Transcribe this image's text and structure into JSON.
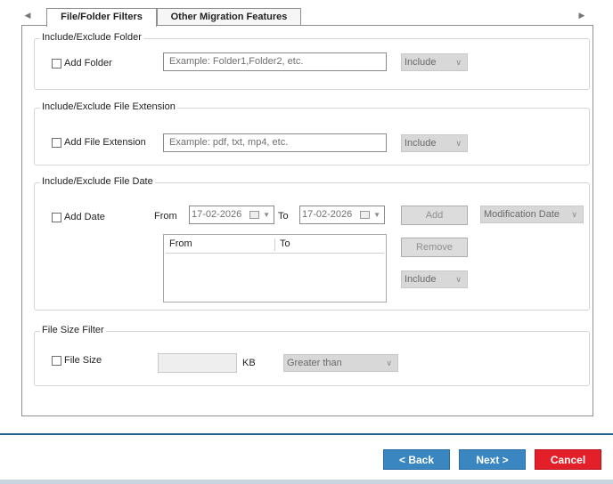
{
  "tabs": [
    {
      "label": "File/Folder Filters",
      "active": true
    },
    {
      "label": "Other Migration Features",
      "active": false
    }
  ],
  "folder_group": {
    "title": "Include/Exclude Folder",
    "checkbox_label": "Add Folder",
    "input_placeholder": "Example: Folder1,Folder2, etc.",
    "select_value": "Include"
  },
  "extension_group": {
    "title": "Include/Exclude File Extension",
    "checkbox_label": "Add File Extension",
    "input_placeholder": "Example: pdf, txt, mp4, etc.",
    "select_value": "Include"
  },
  "date_group": {
    "title": "Include/Exclude File Date",
    "checkbox_label": "Add Date",
    "from_label": "From",
    "from_value": "17-02-2026",
    "to_label": "To",
    "to_value": "17-02-2026",
    "add_label": "Add",
    "date_type_value": "Modification Date",
    "list_columns": [
      "From",
      "To"
    ],
    "remove_label": "Remove",
    "select_value": "Include"
  },
  "size_group": {
    "title": "File Size Filter",
    "checkbox_label": "File Size",
    "unit_label": "KB",
    "comparison_value": "Greater than"
  },
  "footer": {
    "back_label": "< Back",
    "next_label": "Next >",
    "cancel_label": "Cancel"
  },
  "colors": {
    "primary_button": "#3a86c1",
    "cancel_button": "#e3202a",
    "footer_line": "#1f5f8a"
  }
}
